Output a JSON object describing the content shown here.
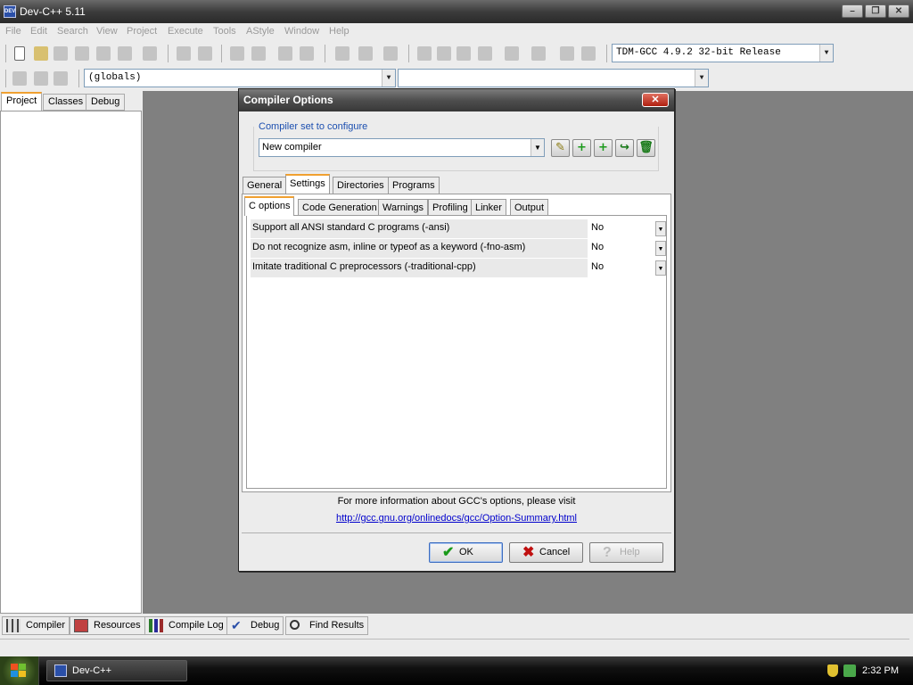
{
  "app": {
    "title": "Dev-C++ 5.11",
    "logo_text": "DEV"
  },
  "window_controls": [
    "–",
    "❐",
    "✕"
  ],
  "menu": [
    "File",
    "Edit",
    "Search",
    "View",
    "Project",
    "Execute",
    "Tools",
    "AStyle",
    "Window",
    "Help"
  ],
  "toolbar": {
    "compiler_select": "TDM-GCC 4.9.2 32-bit Release",
    "scope_select": "(globals)",
    "member_select": ""
  },
  "left_panel": {
    "tabs": [
      "Project",
      "Classes",
      "Debug"
    ],
    "active_tab": "Project"
  },
  "bottom_tabs": [
    "Compiler",
    "Resources",
    "Compile Log",
    "Debug",
    "Find Results"
  ],
  "taskbar": {
    "item": "Dev-C++",
    "clock": "2:32 PM"
  },
  "dialog": {
    "title": "Compiler Options",
    "close": "✕",
    "compiler_set_label": "Compiler set to configure",
    "compiler_set_value": "New compiler",
    "set_buttons": [
      "rename-icon",
      "add-icon",
      "add-icon",
      "export-icon",
      "delete-icon"
    ],
    "main_tabs": [
      "General",
      "Settings",
      "Directories",
      "Programs"
    ],
    "active_main_tab": "Settings",
    "sub_tabs": [
      "C options",
      "Code Generation",
      "Warnings",
      "Profiling",
      "Linker",
      "Output"
    ],
    "active_sub_tab": "C options",
    "options": [
      {
        "label": "Support all ANSI standard C programs (-ansi)",
        "value": "No"
      },
      {
        "label": "Do not recognize asm, inline or typeof as a keyword (-fno-asm)",
        "value": "No"
      },
      {
        "label": "Imitate traditional C preprocessors (-traditional-cpp)",
        "value": "No"
      }
    ],
    "info_text": "For more information about GCC's options, please visit",
    "info_link": "http://gcc.gnu.org/onlinedocs/gcc/Option-Summary.html",
    "buttons": {
      "ok": "OK",
      "cancel": "Cancel",
      "help": "Help"
    }
  },
  "colors": {
    "accent_tab": "#f0a030",
    "link": "#0000cc",
    "label_blue": "#1c4fb0",
    "ok_check": "#1a9a1a",
    "cancel_x": "#c01010"
  }
}
